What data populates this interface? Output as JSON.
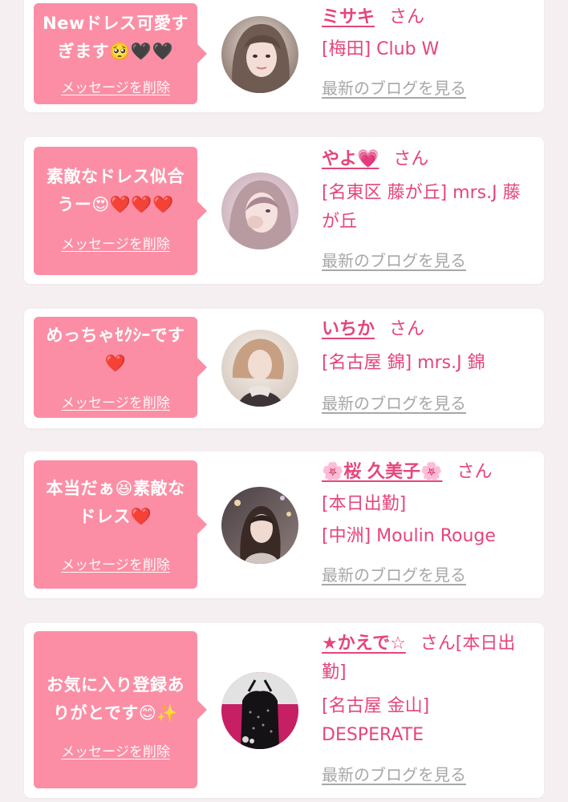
{
  "delete_label": "メッセージを削除",
  "blog_label": "最新のブログを見る",
  "colors": {
    "accent": "#e5457a",
    "bubble": "#fb8ea5",
    "muted": "#a7a7a7",
    "background": "#f5eff1"
  },
  "messages": [
    {
      "text": "Newドレス可愛すぎます🥺🖤🖤",
      "name": "ミサキ",
      "suffix": "さん",
      "details": [
        "[梅田] Club W"
      ]
    },
    {
      "text": "素敵なドレス似合うー😍❤️❤️❤️",
      "name": "やよ💗",
      "suffix": "さん",
      "details": [
        "[名東区 藤が丘] mrs.J 藤が丘"
      ]
    },
    {
      "text": "めっちゃｾｸｼｰです❤️",
      "name": "いちか",
      "suffix": "さん",
      "details": [
        "[名古屋 錦] mrs.J 錦"
      ]
    },
    {
      "text": "本当だぁ😆素敵なドレス❤️",
      "name": "🌸桜 久美子🌸",
      "suffix": "さん",
      "details": [
        "[本日出勤]",
        "[中洲] Moulin Rouge"
      ]
    },
    {
      "text": "お気に入り登録ありがとです😊✨",
      "name": "★かえで☆",
      "suffix": "さん[本日出勤]",
      "details": [
        "[名古屋 金山] DESPERATE"
      ]
    }
  ]
}
